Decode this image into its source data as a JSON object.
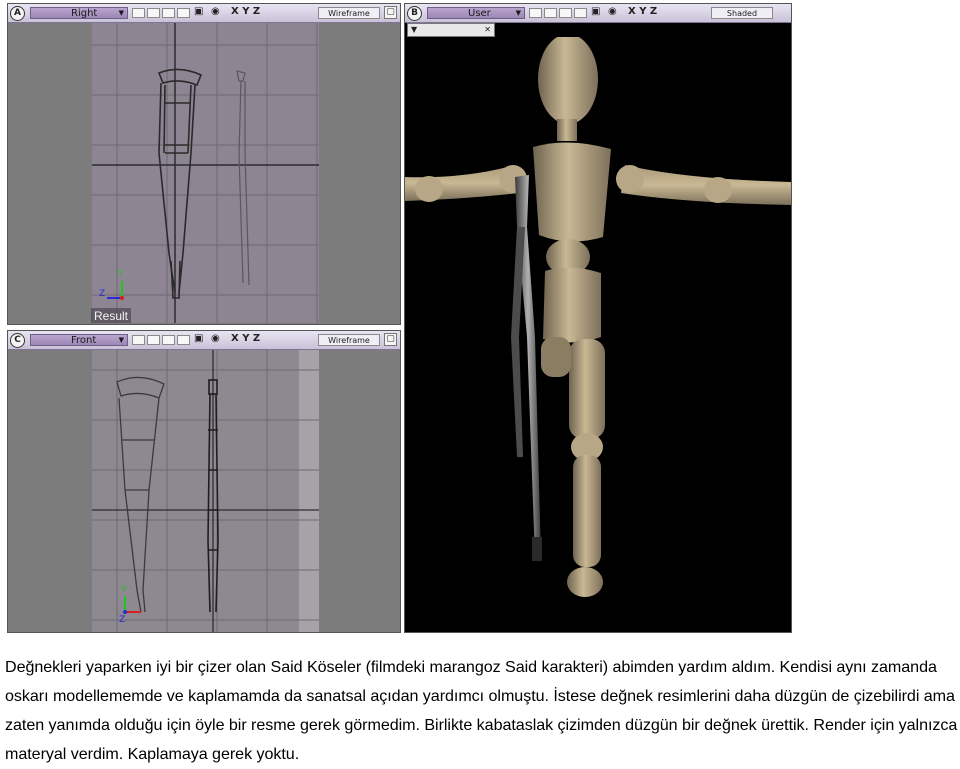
{
  "viewports": {
    "right": {
      "letter": "A",
      "view": "Right",
      "mode": "Wireframe",
      "result_label": "Result"
    },
    "user": {
      "letter": "B",
      "view": "User",
      "mode": "Shaded"
    },
    "front": {
      "letter": "C",
      "view": "Front",
      "mode": "Wireframe"
    }
  },
  "toolbar": {
    "axes": "X Y Z"
  },
  "axis_labels": {
    "y": "Y",
    "z": "Z"
  },
  "colors": {
    "viewport_bg": "#8f8a93",
    "user_bg": "#000000",
    "wood": "#b8a786"
  },
  "caption": {
    "text": "Değnekleri yaparken iyi bir çizer olan Said Köseler (filmdeki marangoz Said karakteri) abimden yardım aldım. Kendisi aynı zamanda oskarı modellememde ve kaplamamda da sanatsal açıdan yardımcı olmuştu. İstese değnek resimlerini daha düzgün de çizebilirdi ama zaten yanımda olduğu için öyle bir resme gerek görmedim. Birlikte kabataslak çizimden düzgün bir değnek ürettik. Render için yalnızca materyal verdim. Kaplamaya gerek yoktu."
  }
}
